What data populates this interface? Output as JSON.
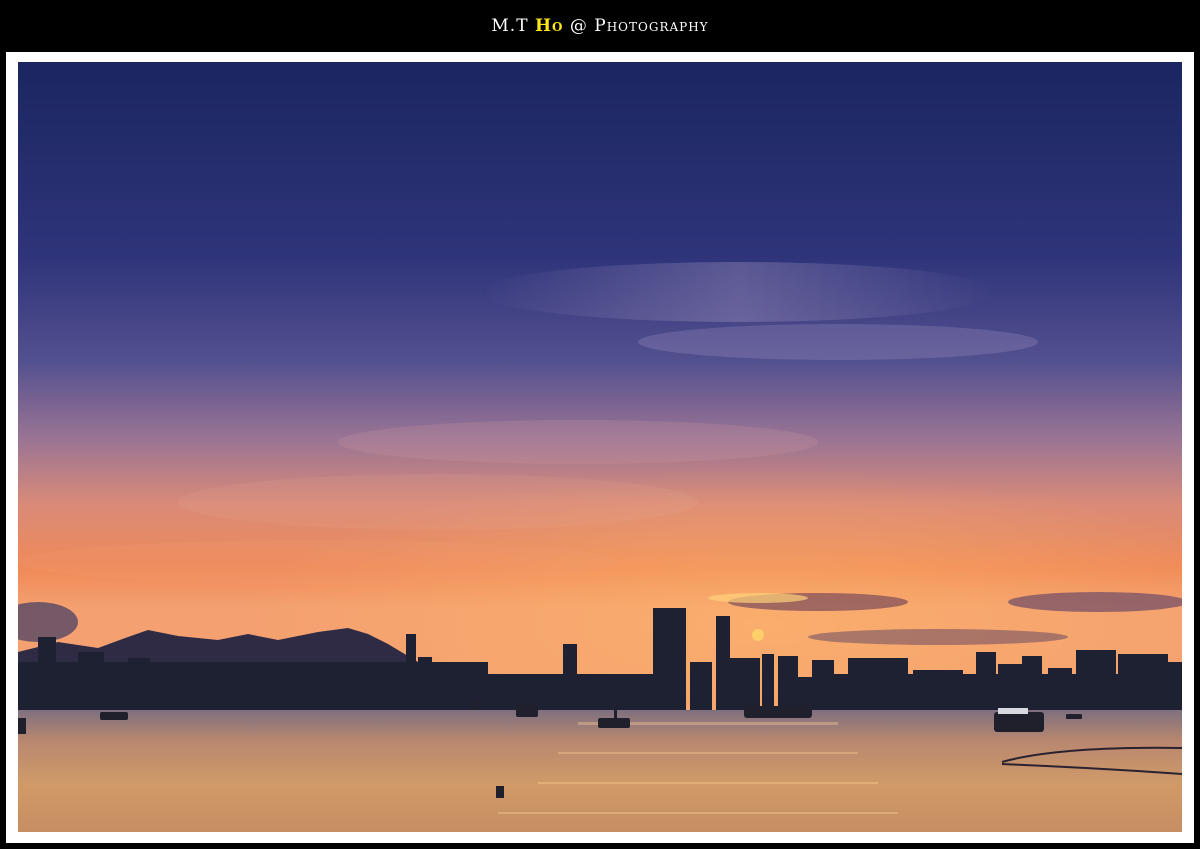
{
  "caption": {
    "prefix": "M.T ",
    "highlight": "Ho",
    "suffix": " @ Photography"
  },
  "colors": {
    "background": "#000000",
    "frame": "#ffffff",
    "caption_text": "#ffffff",
    "caption_highlight": "#ffe81a",
    "sky_top": "#1c2a66",
    "sky_mid": "#5b4f8f",
    "sky_horizon": "#f0855a",
    "water": "#c98a5a"
  }
}
